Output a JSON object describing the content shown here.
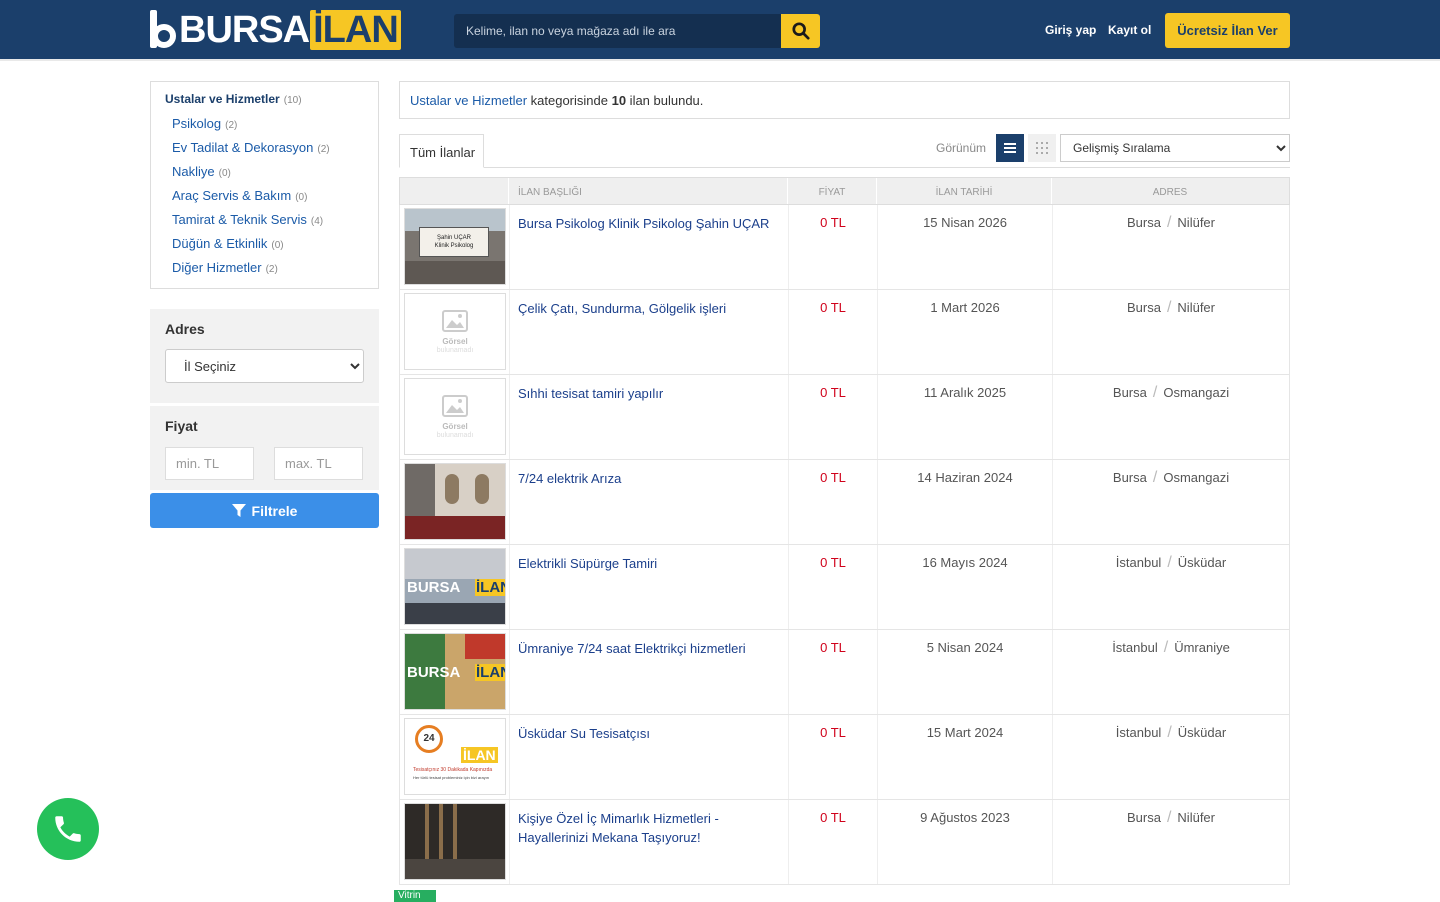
{
  "brand": {
    "name_part1": "BURSA",
    "name_part2": "İLAN"
  },
  "header": {
    "search_placeholder": "Kelime, ilan no veya mağaza adı ile ara",
    "login": "Giriş yap",
    "register": "Kayıt ol",
    "cta": "Ücretsiz İlan Ver"
  },
  "sidebar": {
    "main": {
      "label": "Ustalar ve Hizmetler",
      "count": "(10)"
    },
    "items": [
      {
        "label": "Psikolog",
        "count": "(2)"
      },
      {
        "label": "Ev Tadilat & Dekorasyon",
        "count": "(2)"
      },
      {
        "label": "Nakliye",
        "count": "(0)"
      },
      {
        "label": "Araç Servis & Bakım",
        "count": "(0)"
      },
      {
        "label": "Tamirat & Teknik Servis",
        "count": "(4)"
      },
      {
        "label": "Düğün & Etkinlik",
        "count": "(0)"
      },
      {
        "label": "Diğer Hizmetler",
        "count": "(2)"
      }
    ],
    "address": {
      "title": "Adres",
      "select_value": "İl Seçiniz"
    },
    "price": {
      "title": "Fiyat",
      "min_placeholder": "min. TL",
      "max_placeholder": "max. TL"
    },
    "filter_button": "Filtrele"
  },
  "results": {
    "category": "Ustalar ve Hizmetler",
    "text_mid": " kategorisinde ",
    "count": "10",
    "text_end": " ilan bulundu."
  },
  "toolbar": {
    "tab_all": "Tüm İlanlar",
    "view_label": "Görünüm",
    "sort_value": "Gelişmiş Sıralama"
  },
  "table": {
    "headers": [
      "İLAN BAŞLIĞI",
      "FİYAT",
      "İLAN TARİHİ",
      "ADRES"
    ],
    "rows": [
      {
        "title": "Bursa Psikolog Klinik Psikolog Şahin UÇAR",
        "price": "0 TL",
        "date": "15 Nisan 2026",
        "city": "Bursa",
        "district": "Nilüfer",
        "thumb": "photo-sign"
      },
      {
        "title": "Çelik Çatı, Sundurma, Gölgelik işleri",
        "price": "0 TL",
        "date": "1 Mart 2026",
        "city": "Bursa",
        "district": "Nilüfer",
        "thumb": "placeholder"
      },
      {
        "title": "Sıhhi tesisat tamiri yapılır",
        "price": "0 TL",
        "date": "11 Aralık 2025",
        "city": "Bursa",
        "district": "Osmangazi",
        "thumb": "placeholder"
      },
      {
        "title": "7/24 elektrik Arıza",
        "price": "0 TL",
        "date": "14 Haziran 2024",
        "city": "Bursa",
        "district": "Osmangazi",
        "thumb": "photo-room"
      },
      {
        "title": "Elektrikli Süpürge Tamiri",
        "price": "0 TL",
        "date": "16 Mayıs 2024",
        "city": "İstanbul",
        "district": "Üsküdar",
        "thumb": "photo-logo"
      },
      {
        "title": "Ümraniye 7/24 saat Elektrikçi hizmetleri",
        "price": "0 TL",
        "date": "5 Nisan 2024",
        "city": "İstanbul",
        "district": "Ümraniye",
        "thumb": "photo-tools"
      },
      {
        "title": "Üsküdar Su Tesisatçısı",
        "price": "0 TL",
        "date": "15 Mart 2024",
        "city": "İstanbul",
        "district": "Üsküdar",
        "thumb": "banner-24"
      },
      {
        "title": "Kişiye Özel İç Mimarlık Hizmetleri - Hayallerinizi Mekana Taşıyoruz!",
        "price": "0 TL",
        "date": "9 Ağustos 2023",
        "city": "Bursa",
        "district": "Nilüfer",
        "thumb": "photo-interior"
      }
    ]
  },
  "placeholder_thumb": {
    "line1": "Görsel",
    "line2": "bulunamadı"
  },
  "thumb_sign_text": [
    "Şahin UÇAR",
    "Klinik Psikolog"
  ],
  "thumb_banner_text": [
    "24",
    "İLAN",
    "Tesisatçınız 30 Dakikada Kapınızda",
    "Her türlü tesisat probleminiz için bizi arayın"
  ],
  "vitrin_badge": "Vitrin",
  "colors": {
    "header_bg": "#1b3f6b",
    "accent_yellow": "#f6c624",
    "link_blue": "#1b5ba8",
    "price_red": "#d0021b",
    "filter_blue": "#3b8fe8",
    "whatsapp_green": "#25c05a"
  },
  "icons": {
    "search": "search-icon",
    "filter": "filter-icon",
    "list_view": "list-icon",
    "grid_view": "grid-icon",
    "whatsapp": "phone-icon"
  }
}
